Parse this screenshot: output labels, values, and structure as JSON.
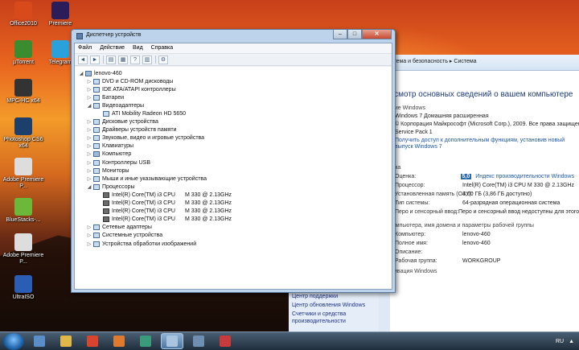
{
  "desktop": {
    "icons": [
      {
        "label": "Office2010",
        "color": "#d84a1b"
      },
      {
        "label": "Premiere",
        "color": "#2b1d5a"
      },
      {
        "label": "µTorrent",
        "color": "#3a8c2f"
      },
      {
        "label": "Telegram",
        "color": "#2aa1da"
      },
      {
        "label": "MPC-HC x64",
        "color": "#333333"
      },
      {
        "label": "Photoshop CS6 x64",
        "color": "#1c3f6b"
      },
      {
        "label": "Adobe Premiere P...",
        "color": "#dddddd"
      },
      {
        "label": "BlueStacks-...",
        "color": "#6cb83a"
      },
      {
        "label": "Adobe Premiere P...",
        "color": "#dddddd"
      },
      {
        "label": "UltraISO",
        "color": "#2b5db5"
      }
    ]
  },
  "device_manager": {
    "title": "Диспетчер устройств",
    "controls": {
      "minimize": "–",
      "maximize": "□",
      "close": "✕"
    },
    "menu": [
      "Файл",
      "Действие",
      "Вид",
      "Справка"
    ],
    "toolbar": [
      "◄",
      "►",
      "▤",
      "▦",
      "?",
      "▥",
      "⚙"
    ],
    "tree": [
      {
        "label": "lenovo-460",
        "level": 0,
        "expander": "◢",
        "icon": "comp"
      },
      {
        "label": "DVD и CD-ROM дисководы",
        "level": 1,
        "expander": "▷",
        "icon": "dev"
      },
      {
        "label": "IDE ATA/ATAPI контроллеры",
        "level": 1,
        "expander": "▷",
        "icon": "dev"
      },
      {
        "label": "Батареи",
        "level": 1,
        "expander": "▷",
        "icon": "dev"
      },
      {
        "label": "Видеоадаптеры",
        "level": 1,
        "expander": "◢",
        "icon": "dev"
      },
      {
        "label": "ATI Mobility Radeon HD 5650",
        "level": 2,
        "expander": "",
        "icon": "dev"
      },
      {
        "label": "Дисковые устройства",
        "level": 1,
        "expander": "▷",
        "icon": "dev"
      },
      {
        "label": "Драйверы устройств памяти",
        "level": 1,
        "expander": "▷",
        "icon": "dev"
      },
      {
        "label": "Звуковые, видео и игровые устройства",
        "level": 1,
        "expander": "▷",
        "icon": "dev"
      },
      {
        "label": "Клавиатуры",
        "level": 1,
        "expander": "▷",
        "icon": "dev"
      },
      {
        "label": "Компьютер",
        "level": 1,
        "expander": "▷",
        "icon": "comp"
      },
      {
        "label": "Контроллеры USB",
        "level": 1,
        "expander": "▷",
        "icon": "dev"
      },
      {
        "label": "Мониторы",
        "level": 1,
        "expander": "▷",
        "icon": "dev"
      },
      {
        "label": "Мыши и иные указывающие устройства",
        "level": 1,
        "expander": "▷",
        "icon": "dev"
      },
      {
        "label": "Процессоры",
        "level": 1,
        "expander": "◢",
        "icon": "dev"
      },
      {
        "label": "Intel(R) Core(TM) i3 CPU",
        "speed": "M 330  @ 2.13GHz",
        "level": 2,
        "expander": "",
        "icon": "cpu"
      },
      {
        "label": "Intel(R) Core(TM) i3 CPU",
        "speed": "M 330  @ 2.13GHz",
        "level": 2,
        "expander": "",
        "icon": "cpu"
      },
      {
        "label": "Intel(R) Core(TM) i3 CPU",
        "speed": "M 330  @ 2.13GHz",
        "level": 2,
        "expander": "",
        "icon": "cpu"
      },
      {
        "label": "Intel(R) Core(TM) i3 CPU",
        "speed": "M 330  @ 2.13GHz",
        "level": 2,
        "expander": "",
        "icon": "cpu"
      },
      {
        "label": "Сетевые адаптеры",
        "level": 1,
        "expander": "▷",
        "icon": "dev"
      },
      {
        "label": "Системные устройства",
        "level": 1,
        "expander": "▷",
        "icon": "dev"
      },
      {
        "label": "Устройства обработки изображений",
        "level": 1,
        "expander": "▷",
        "icon": "dev"
      }
    ]
  },
  "system_window": {
    "address": "Система и безопасность  ▸  Система",
    "heading": "росмотр основных сведений о вашем компьютере",
    "edition_section": "дание Windows",
    "edition_name": "Windows 7 Домашняя расширенная",
    "copyright": "© Корпорация Майкрософт (Microsoft Corp.), 2009. Все права защищены.",
    "service_pack": "Service Pack 1",
    "upgrade_link": "Получить доступ к дополнительным функциям, установив новый выпуск Windows 7",
    "system_section": "стема",
    "rating_label": "Оценка:",
    "rating_score": "5,0",
    "rating_link": "Индекс производительности Windows",
    "rows": [
      {
        "k": "Процессор:",
        "v": "Intel(R) Core(TM) i3 CPU      M 330  @ 2.13GHz"
      },
      {
        "k": "Установленная память (ОЗУ):",
        "v": "4,00 ГБ (3,86 ГБ доступно)"
      },
      {
        "k": "Тип системы:",
        "v": "64-разрядная операционная система"
      },
      {
        "k": "Перо и сенсорный ввод:",
        "v": "Перо и сенсорный ввод недоступны для этого экрана"
      }
    ],
    "name_section": "я компьютера, имя домена и параметры рабочей группы",
    "name_rows": [
      {
        "k": "Компьютер:",
        "v": "lenovo-460"
      },
      {
        "k": "Полное имя:",
        "v": "lenovo-460"
      },
      {
        "k": "Описание:",
        "v": ""
      },
      {
        "k": "Рабочая группа:",
        "v": "WORKGROUP"
      }
    ],
    "activation": "Активация Windows",
    "see_also": [
      "Центр поддержки",
      "Центр обновления Windows",
      "Счетчики и средства производительности"
    ]
  },
  "taskbar": {
    "apps": [
      {
        "color": "#5b8dc8"
      },
      {
        "color": "#e0b84a"
      },
      {
        "color": "#d9442f"
      },
      {
        "color": "#e07a2e"
      },
      {
        "color": "#3a9b7a"
      },
      {
        "color": "#aac4e0"
      },
      {
        "color": "#6f8fb2"
      },
      {
        "color": "#c93a3a"
      }
    ],
    "lang": "RU"
  }
}
